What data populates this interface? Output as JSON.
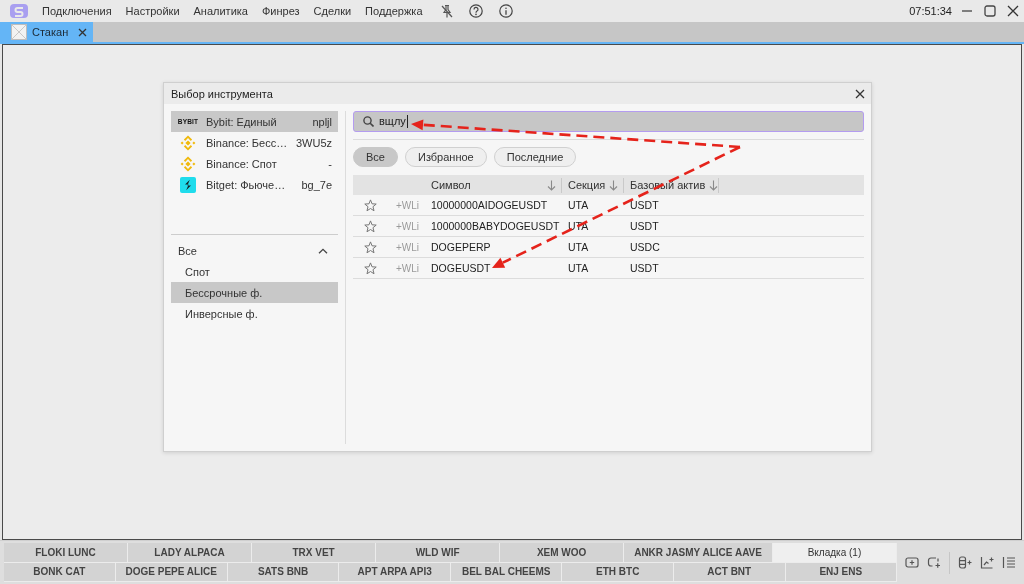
{
  "top_bar": {
    "menu": [
      "Подключения",
      "Настройки",
      "Аналитика",
      "Финрез",
      "Сделки",
      "Поддержка"
    ],
    "clock": "07:51:34"
  },
  "tabs": [
    {
      "label": "Стакан",
      "selected": true
    }
  ],
  "dialog": {
    "title": "Выбор инструмента",
    "accounts": [
      {
        "kind": "bybit",
        "logo_text": "BYBIT",
        "name": "Bybit: Единый",
        "account": "npljl",
        "selected": true
      },
      {
        "kind": "binance",
        "name": "Binance: Бесс…",
        "account": "3WU5z",
        "selected": false
      },
      {
        "kind": "binance",
        "name": "Binance: Спот",
        "account": "-",
        "selected": false
      },
      {
        "kind": "bitget",
        "name": "Bitget: Фьюче…",
        "account": "bg_7e",
        "selected": false
      }
    ],
    "market_filter": {
      "label": "Все",
      "expanded": true,
      "children": [
        {
          "label": "Спот",
          "selected": false
        },
        {
          "label": "Бессрочные ф.",
          "selected": true
        },
        {
          "label": "Инверсные ф.",
          "selected": false
        }
      ]
    },
    "search": {
      "value": "вщлу",
      "focused": true
    },
    "filters": [
      {
        "label": "Все",
        "selected": true
      },
      {
        "label": "Избранное",
        "selected": false
      },
      {
        "label": "Последние",
        "selected": false
      }
    ],
    "table": {
      "columns": [
        {
          "label": "Символ"
        },
        {
          "label": "Секция"
        },
        {
          "label": "Базовый актив"
        }
      ],
      "rows": [
        {
          "favorite": false,
          "watchlist": "+WLi",
          "symbol": "10000000AIDOGEUSDT",
          "section": "UTA",
          "base": "USDT"
        },
        {
          "favorite": false,
          "watchlist": "+WLi",
          "symbol": "1000000BABYDOGEUSDT",
          "section": "UTA",
          "base": "USDT"
        },
        {
          "favorite": false,
          "watchlist": "+WLi",
          "symbol": "DOGEPERP",
          "section": "UTA",
          "base": "USDC"
        },
        {
          "favorite": false,
          "watchlist": "+WLi",
          "symbol": "DOGEUSDT",
          "section": "UTA",
          "base": "USDT"
        }
      ]
    }
  },
  "annotations": [
    {
      "kind": "dashed-arrow"
    },
    {
      "kind": "dashed-arrow"
    }
  ],
  "bottom_tabs": [
    {
      "tabs": [
        {
          "label": "FLOKI LUNC",
          "selected": false
        },
        {
          "label": "LADY ALPACA",
          "selected": false
        },
        {
          "label": "TRX VET",
          "selected": false
        },
        {
          "label": "WLD WIF",
          "selected": false
        },
        {
          "label": "XEM WOO",
          "selected": false
        },
        {
          "label": "ANKR JASMY ALICE AAVE",
          "selected": false
        },
        {
          "label": "Вкладка (1)",
          "selected": true
        }
      ]
    },
    {
      "tabs": [
        {
          "label": "BONK CAT",
          "selected": false
        },
        {
          "label": "DOGE PEPE ALICE",
          "selected": false
        },
        {
          "label": "SATS BNB",
          "selected": false
        },
        {
          "label": "APT ARPA API3",
          "selected": false
        },
        {
          "label": "BEL BAL CHEEMS",
          "selected": false
        },
        {
          "label": "ETH BTC",
          "selected": false
        },
        {
          "label": "ACT BNT",
          "selected": false
        },
        {
          "label": "ENJ ENS",
          "selected": false
        }
      ]
    }
  ]
}
